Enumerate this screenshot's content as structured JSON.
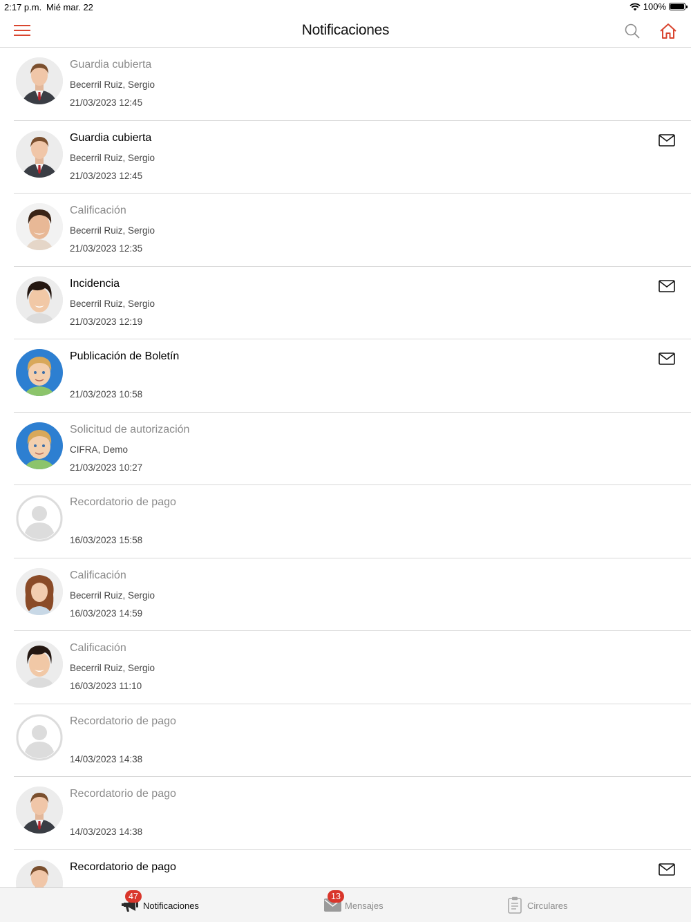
{
  "status": {
    "time": "2:17 p.m.",
    "date": "Mié mar. 22",
    "battery": "100%"
  },
  "header": {
    "title": "Notificaciones",
    "accent_color": "#d9452f"
  },
  "notifications": [
    {
      "title": "Guardia cubierta",
      "author": "Becerril Ruiz, Sergio",
      "date": "21/03/2023 12:45",
      "unread": false,
      "mail": false,
      "avatar": "man-suit-avatar"
    },
    {
      "title": "Guardia cubierta",
      "author": "Becerril Ruiz, Sergio",
      "date": "21/03/2023 12:45",
      "unread": true,
      "mail": true,
      "avatar": "man-suit-avatar"
    },
    {
      "title": "Calificación",
      "author": "Becerril Ruiz, Sergio",
      "date": "21/03/2023 12:35",
      "unread": false,
      "mail": false,
      "avatar": "young-man-avatar"
    },
    {
      "title": "Incidencia",
      "author": "Becerril Ruiz, Sergio",
      "date": "21/03/2023 12:19",
      "unread": true,
      "mail": true,
      "avatar": "boy-dark-hair-avatar"
    },
    {
      "title": "Publicación de Boletín",
      "author": "",
      "date": "21/03/2023 10:58",
      "unread": true,
      "mail": true,
      "avatar": "blond-boy-avatar"
    },
    {
      "title": "Solicitud de autorización",
      "author": "CIFRA, Demo",
      "date": "21/03/2023 10:27",
      "unread": false,
      "mail": false,
      "avatar": "blond-boy-avatar"
    },
    {
      "title": "Recordatorio de pago",
      "author": "",
      "date": "16/03/2023 15:58",
      "unread": false,
      "mail": false,
      "avatar": "default-user-avatar"
    },
    {
      "title": "Calificación",
      "author": "Becerril Ruiz, Sergio",
      "date": "16/03/2023 14:59",
      "unread": false,
      "mail": false,
      "avatar": "girl-avatar"
    },
    {
      "title": "Calificación",
      "author": "Becerril Ruiz, Sergio",
      "date": "16/03/2023 11:10",
      "unread": false,
      "mail": false,
      "avatar": "boy-dark-hair-avatar"
    },
    {
      "title": "Recordatorio de pago",
      "author": "",
      "date": "14/03/2023 14:38",
      "unread": false,
      "mail": false,
      "avatar": "default-user-avatar"
    },
    {
      "title": "Recordatorio de pago",
      "author": "",
      "date": "14/03/2023 14:38",
      "unread": false,
      "mail": false,
      "avatar": "man-suit-avatar"
    },
    {
      "title": "Recordatorio de pago",
      "author": "",
      "date": "",
      "unread": true,
      "mail": true,
      "avatar": "man-suit-avatar"
    }
  ],
  "tabs": [
    {
      "label": "Notificaciones",
      "badge": "47",
      "active": true,
      "icon": "megaphone-icon"
    },
    {
      "label": "Mensajes",
      "badge": "13",
      "active": false,
      "icon": "envelope-icon"
    },
    {
      "label": "Circulares",
      "badge": "",
      "active": false,
      "icon": "clipboard-icon"
    }
  ]
}
